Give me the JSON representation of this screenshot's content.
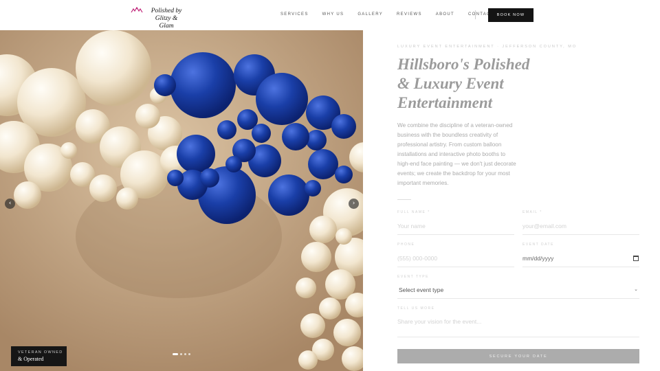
{
  "brand": {
    "logo_line1": "Polished by",
    "logo_line2": "Glitzy & Glam",
    "accent_color": "#c0267a"
  },
  "nav": {
    "items": [
      "SERVICES",
      "WHY US",
      "GALLERY",
      "REVIEWS",
      "ABOUT",
      "CONTACT"
    ],
    "cta": "BOOK NOW"
  },
  "hero": {
    "prev_icon": "chevron-left-icon",
    "next_icon": "chevron-right-icon",
    "prev_glyph": "‹",
    "next_glyph": "›",
    "slides_total": 4,
    "active_slide": 1,
    "badge_sub": "VETERAN OWNED",
    "badge_main": "& Operated"
  },
  "content": {
    "eyebrow": "LUXURY EVENT ENTERTAINMENT · JEFFERSON COUNTY, MO",
    "title": "Hillsboro's Polished & Luxury Event Entertainment",
    "description": "We combine the discipline of a veteran-owned business with the boundless creativity of professional artistry. From custom balloon installations and interactive photo booths to high-end face painting — we don't just decorate events; we create the backdrop for your most important memories."
  },
  "form": {
    "full_name_label": "FULL NAME *",
    "full_name_placeholder": "Your name",
    "email_label": "EMAIL *",
    "email_placeholder": "your@email.com",
    "phone_label": "PHONE",
    "phone_placeholder": "(555) 000-0000",
    "date_label": "EVENT DATE",
    "date_placeholder": "mm/dd/yyyy",
    "event_type_label": "EVENT TYPE",
    "event_type_value": "Select event type",
    "more_label": "TELL US MORE",
    "more_placeholder": "Share your vision for the event...",
    "submit": "SECURE YOUR DATE"
  }
}
